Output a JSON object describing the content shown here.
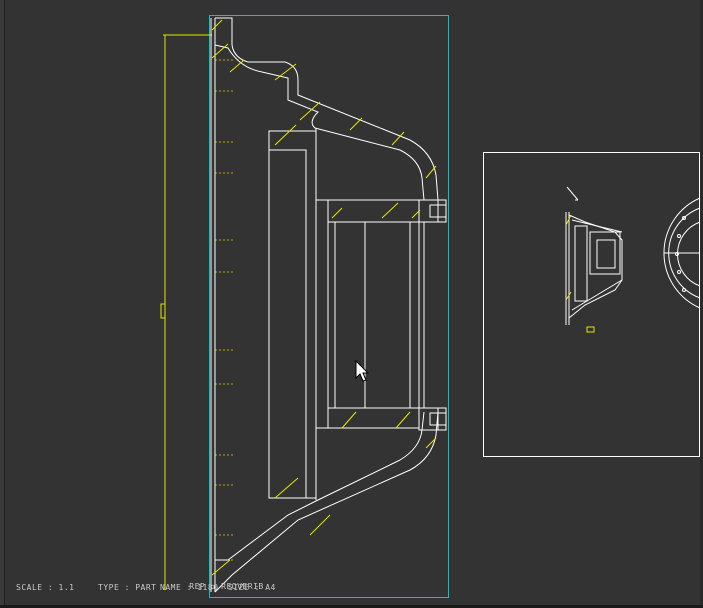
{
  "window": {
    "mode": "drawing-view",
    "colors": {
      "background": "#333333",
      "geometry": "#ffffff",
      "hatch": "#e6e600",
      "dimension": "#e6e600",
      "selection_box": "#00c8c8",
      "status_text": "#c8c8c8"
    }
  },
  "status": {
    "scale": "SCALE : 1.1",
    "type": "TYPE : PART",
    "name": "NAME : 1180",
    "size": "SIZE : A4",
    "rep": "REP : RE",
    "rep_suffix": "OVERIB"
  },
  "cursor": {
    "icon": "arrow-pointer-icon"
  }
}
